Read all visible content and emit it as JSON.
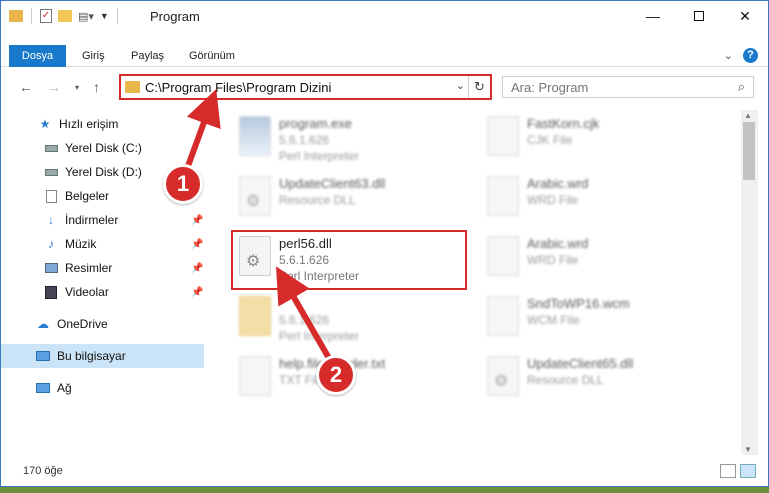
{
  "window": {
    "title": "Program"
  },
  "ribbon": {
    "tabs": [
      {
        "label": "Dosya",
        "active": true
      },
      {
        "label": "Giriş"
      },
      {
        "label": "Paylaş"
      },
      {
        "label": "Görünüm"
      }
    ],
    "help_label": "?"
  },
  "nav": {
    "address_path": "C:\\Program Files\\Program Dizini",
    "search_placeholder": "Ara: Program"
  },
  "sidebar": {
    "items": [
      {
        "label": "Hızlı erişim",
        "icon": "star-icon"
      },
      {
        "label": "Yerel Disk (C:)",
        "icon": "drive-icon"
      },
      {
        "label": "Yerel Disk (D:)",
        "icon": "drive-icon"
      },
      {
        "label": "Belgeler",
        "icon": "documents-icon"
      },
      {
        "label": "İndirmeler",
        "icon": "download-icon"
      },
      {
        "label": "Müzik",
        "icon": "music-icon"
      },
      {
        "label": "Resimler",
        "icon": "pictures-icon"
      },
      {
        "label": "Videolar",
        "icon": "video-icon"
      },
      {
        "label": "OneDrive",
        "icon": "cloud-icon"
      },
      {
        "label": "Bu bilgisayar",
        "icon": "computer-icon",
        "selected": true
      },
      {
        "label": "Ağ",
        "icon": "network-icon"
      }
    ]
  },
  "files": [
    {
      "name": "program.exe",
      "version": "5.6.1.626",
      "type": "Perl Interpreter",
      "icon": "exe-icon"
    },
    {
      "name": "UpdateClient63.dll",
      "type": "Resource DLL",
      "icon": "dll-gear-icon"
    },
    {
      "name": "perl56.dll",
      "version": "5.6.1.626",
      "type": "Perl Interpreter",
      "icon": "dll-gear-icon"
    },
    {
      "name": "",
      "version": "5.6.1.626",
      "type": "Perl Interpreter",
      "icon": "folder-file-icon"
    },
    {
      "name": "help.file_reader.txt",
      "type": "TXT File",
      "icon": "txt-icon"
    },
    {
      "name": "FastKorn.cjk",
      "type": "CJK File",
      "icon": "file-icon"
    },
    {
      "name": "Arabic.wrd",
      "type": "WRD File",
      "icon": "file-icon"
    },
    {
      "name": "Arabic.wrd",
      "type": "WRD File",
      "icon": "file-icon"
    },
    {
      "name": "SndToWP16.wcm",
      "type": "WCM File",
      "icon": "file-icon"
    },
    {
      "name": "UpdateClient65.dll",
      "type": "Resource DLL",
      "icon": "dll-gear-icon"
    }
  ],
  "status": {
    "item_count": "170 öğe"
  },
  "callouts": {
    "first": "1",
    "second": "2"
  },
  "colors": {
    "accent": "#1979ca",
    "highlight": "#d72b2b"
  }
}
